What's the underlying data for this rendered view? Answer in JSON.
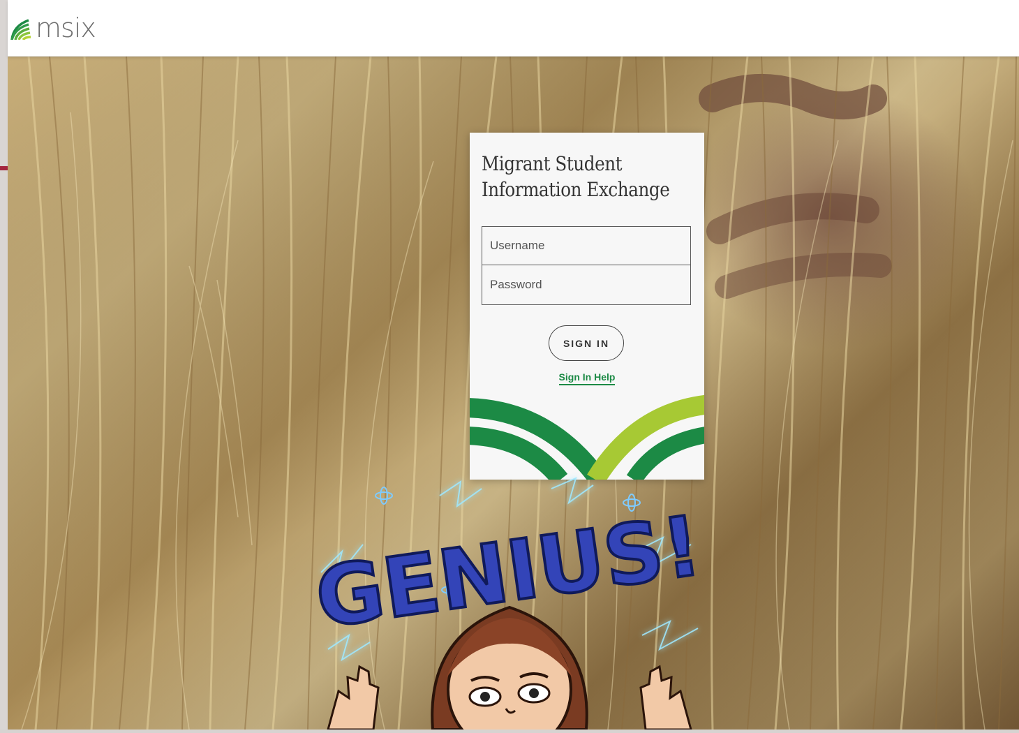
{
  "header": {
    "logo_text": "msix",
    "logo_icon": "msix-logo-icon"
  },
  "card": {
    "title_line1": "Migrant Student",
    "title_line2": "Information Exchange",
    "username_placeholder": "Username",
    "password_placeholder": "Password",
    "signin_label": "SIGN IN",
    "help_label": "Sign In Help"
  },
  "sticker": {
    "text": "GENIUS!"
  },
  "colors": {
    "brand_green": "#1c8a45",
    "brand_lime": "#8dc63f",
    "accent_red": "#a3253d",
    "sticker_blue": "#2d3cb0"
  }
}
